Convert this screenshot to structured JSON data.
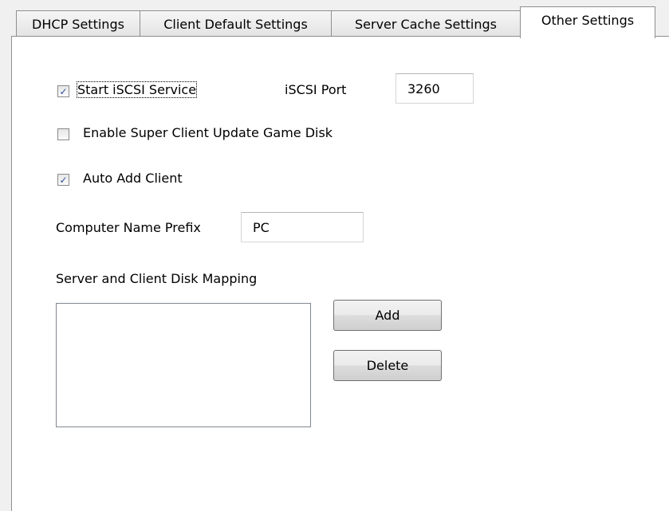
{
  "tabs": [
    {
      "label": "DHCP Settings",
      "active": false
    },
    {
      "label": "Client Default Settings",
      "active": false
    },
    {
      "label": "Server Cache Settings",
      "active": false
    },
    {
      "label": "Other Settings",
      "active": true
    }
  ],
  "other_settings": {
    "start_iscsi": {
      "label": "Start iSCSI Service",
      "checked": true
    },
    "iscsi_port": {
      "label": "iSCSI Port",
      "value": "3260"
    },
    "super_client": {
      "label": "Enable Super Client Update Game Disk",
      "checked": false
    },
    "auto_add_client": {
      "label": "Auto Add Client",
      "checked": true
    },
    "computer_name_prefix": {
      "label": "Computer Name Prefix",
      "value": "PC"
    },
    "disk_mapping": {
      "label": "Server and Client Disk Mapping",
      "items": [],
      "add_label": "Add",
      "delete_label": "Delete"
    }
  },
  "check_glyph": "✓"
}
